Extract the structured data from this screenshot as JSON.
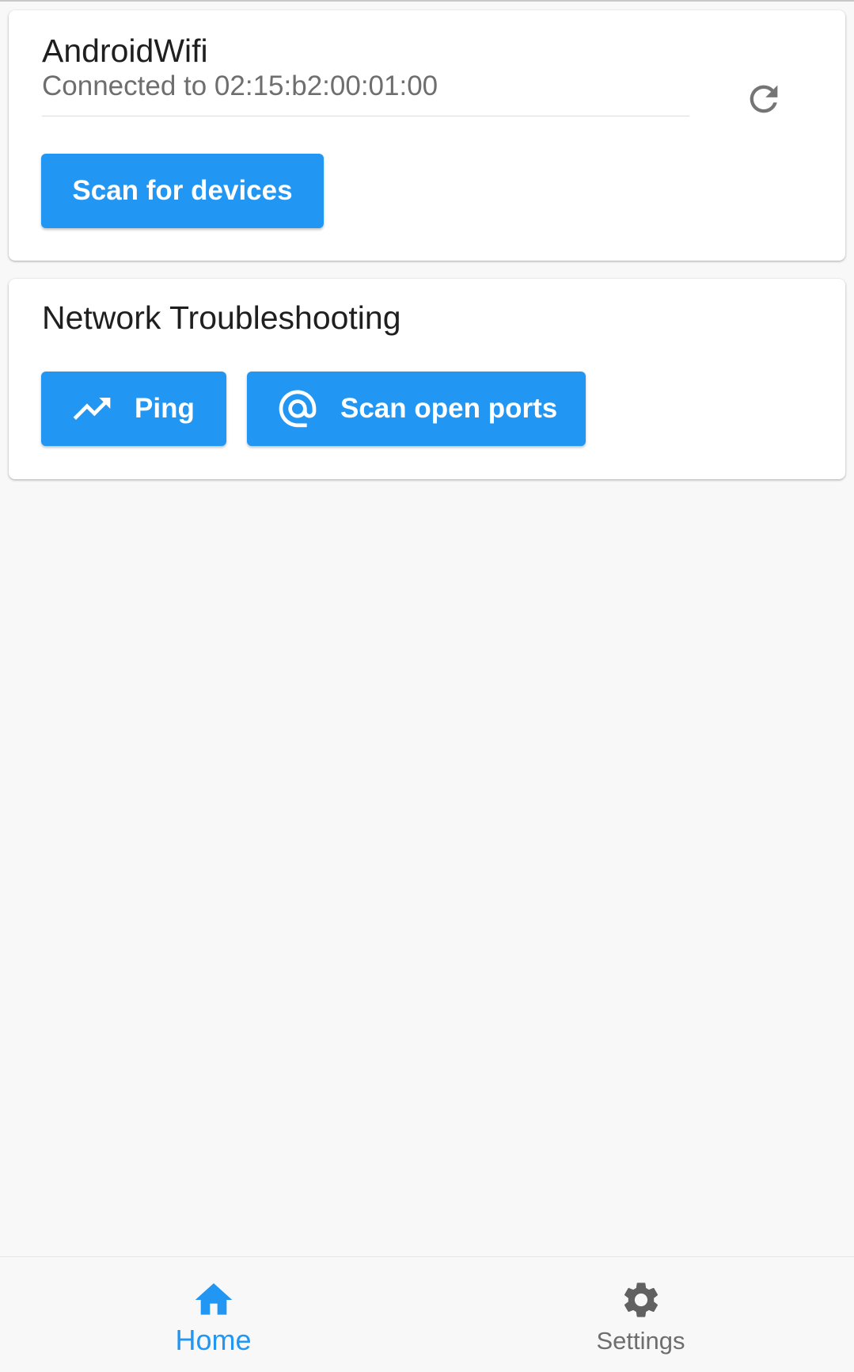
{
  "wifi_card": {
    "network_name": "AndroidWifi",
    "status": "Connected to 02:15:b2:00:01:00",
    "refresh_icon": "refresh-icon",
    "scan_button_label": "Scan for devices"
  },
  "troubleshooting_card": {
    "title": "Network Troubleshooting",
    "ping_button_label": "Ping",
    "ping_icon": "trending-up-icon",
    "ports_button_label": "Scan open ports",
    "ports_icon": "at-sign-icon"
  },
  "bottom_nav": {
    "items": [
      {
        "label": "Home",
        "icon": "home-icon",
        "active": true
      },
      {
        "label": "Settings",
        "icon": "gear-icon",
        "active": false
      }
    ]
  },
  "colors": {
    "accent": "#2196f3",
    "background": "#f8f8f8",
    "card": "#ffffff",
    "inactive": "#6e6e6e"
  }
}
